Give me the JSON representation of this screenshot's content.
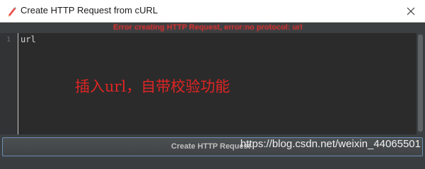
{
  "window": {
    "title": "Create HTTP Request from cURL",
    "app_icon": "pencil-icon",
    "close_icon": "close-icon"
  },
  "error": {
    "message": "Error creating HTTP Request, error:no protocol: url",
    "color": "#e03030"
  },
  "editor": {
    "line_numbers": [
      "1"
    ],
    "lines": [
      "url"
    ],
    "background": "#2b2b2b"
  },
  "annotation": {
    "text": "插入url，自带校验功能",
    "color": "#e02424"
  },
  "actions": {
    "create_label": "Create HTTP Request"
  },
  "watermark": {
    "text": "https://blog.csdn.net/weixin_44065501"
  }
}
